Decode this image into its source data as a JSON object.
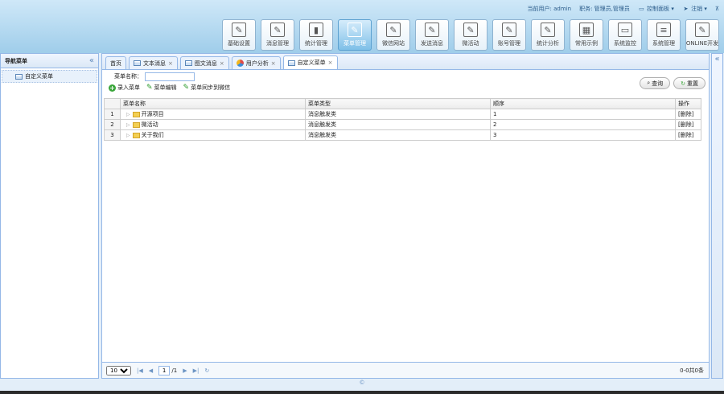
{
  "header": {
    "current_user_label": "当前用户: ",
    "current_user": "admin",
    "role_label": "职务: ",
    "role": "管理员,管理员",
    "control_panel": "控制面板",
    "logout": "注销",
    "nav": [
      {
        "label": "基础设置",
        "icon": "edit-icon"
      },
      {
        "label": "消息管理",
        "icon": "edit-icon"
      },
      {
        "label": "统计管理",
        "icon": "bar-chart-icon"
      },
      {
        "label": "菜单管理",
        "icon": "edit-icon",
        "active": true
      },
      {
        "label": "微信网站",
        "icon": "edit-icon"
      },
      {
        "label": "发送消息",
        "icon": "edit-icon"
      },
      {
        "label": "微活动",
        "icon": "edit-icon"
      },
      {
        "label": "账号管理",
        "icon": "edit-icon"
      },
      {
        "label": "统计分析",
        "icon": "edit-icon"
      },
      {
        "label": "常用示例",
        "icon": "grid-icon"
      },
      {
        "label": "系统监控",
        "icon": "monitor-icon"
      },
      {
        "label": "系统管理",
        "icon": "sliders-icon"
      },
      {
        "label": "ONLINE开发",
        "icon": "edit-icon"
      }
    ]
  },
  "left": {
    "title": "导航菜单",
    "items": [
      "自定义菜单"
    ]
  },
  "tabs": [
    {
      "label": "首页",
      "closable": false
    },
    {
      "label": "文本消息",
      "closable": true
    },
    {
      "label": "图文消息",
      "closable": true
    },
    {
      "label": "用户分析",
      "closable": true
    },
    {
      "label": "自定义菜单",
      "closable": true,
      "active": true
    }
  ],
  "search": {
    "menu_name_label": "菜单名称：",
    "menu_name_value": "",
    "tools": [
      "录入菜单",
      "菜单编辑",
      "菜单同步到微信"
    ],
    "query": "查询",
    "reset": "重置"
  },
  "grid": {
    "columns": [
      "菜单名称",
      "菜单类型",
      "顺序",
      "操作"
    ],
    "rows": [
      {
        "n": "1",
        "name": "开源项目",
        "type": "消息触发类",
        "order": "1",
        "op": "[删除]"
      },
      {
        "n": "2",
        "name": "微活动",
        "type": "消息触发类",
        "order": "2",
        "op": "[删除]"
      },
      {
        "n": "3",
        "name": "关于我们",
        "type": "消息触发类",
        "order": "3",
        "op": "[删除]"
      }
    ]
  },
  "pager": {
    "page_size": "10",
    "page": "1",
    "total_pages": "/1",
    "info": "0-0共0条"
  },
  "footer": {
    "copyright": "©"
  }
}
